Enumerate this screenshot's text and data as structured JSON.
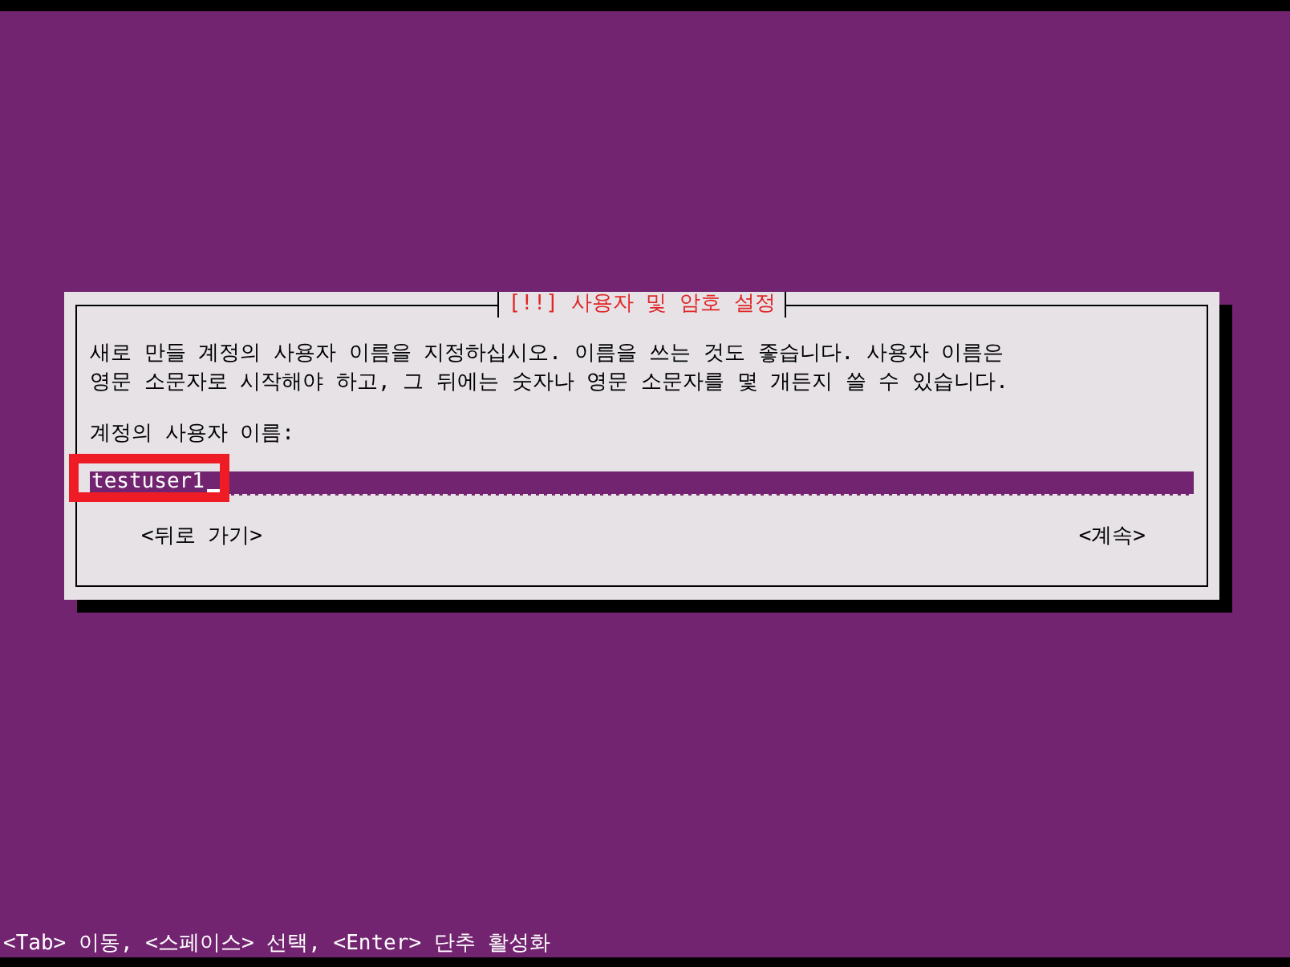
{
  "dialog": {
    "title": "[!!] 사용자 및 암호 설정",
    "description": [
      "새로 만들 계정의 사용자 이름을 지정하십시오. 이름을 쓰는 것도 좋습니다. 사용자 이름은",
      "영문 소문자로 시작해야 하고, 그 뒤에는 숫자나 영문 소문자를 몇 개든지 쓸 수 있습니다."
    ],
    "field_label": "계정의 사용자 이름:",
    "input": {
      "value": "testuser1",
      "highlighted": true
    },
    "buttons": [
      {
        "label": "<뒤로 가기>",
        "selected": false
      },
      {
        "label": "<계속>",
        "selected": false
      }
    ]
  },
  "status_bar": "<Tab> 이동, <스페이스> 선택, <Enter> 단추 활성화"
}
